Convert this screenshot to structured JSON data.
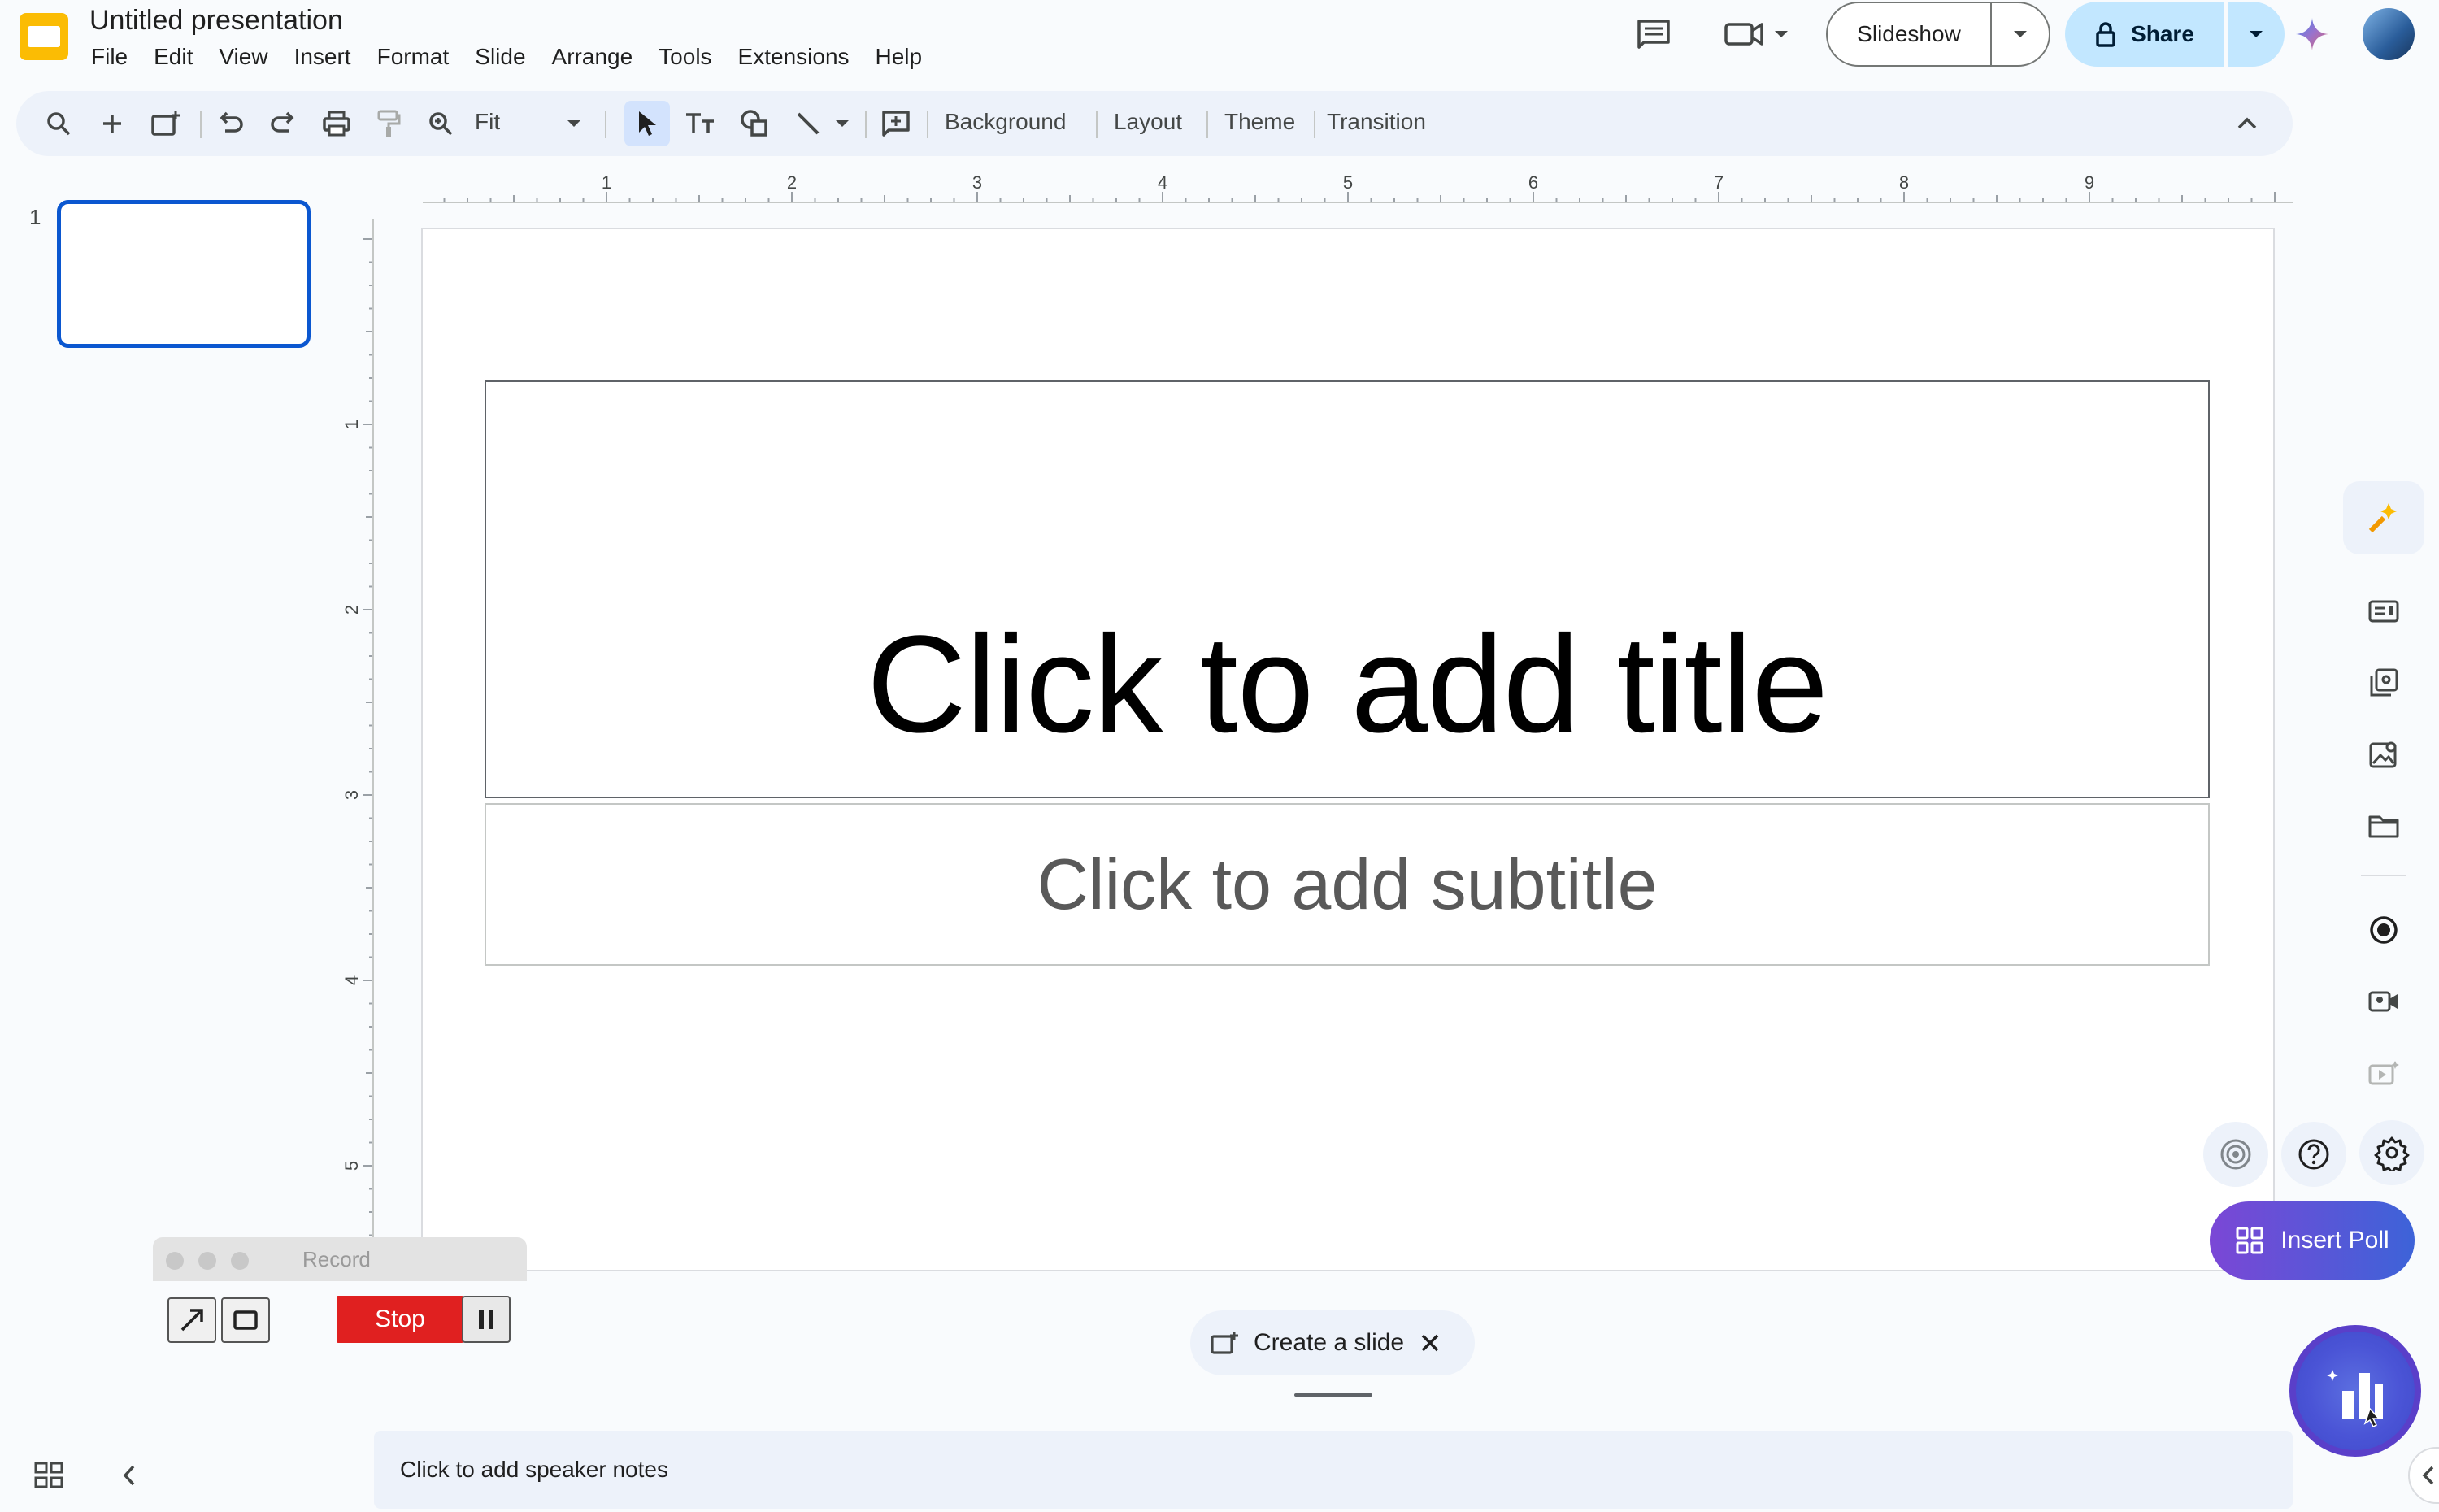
{
  "header": {
    "title": "Untitled presentation",
    "menu": [
      "File",
      "Edit",
      "View",
      "Insert",
      "Format",
      "Slide",
      "Arrange",
      "Tools",
      "Extensions",
      "Help"
    ],
    "slideshow_label": "Slideshow",
    "share_label": "Share"
  },
  "toolbar": {
    "zoom_value": "Fit",
    "background_label": "Background",
    "layout_label": "Layout",
    "theme_label": "Theme",
    "transition_label": "Transition"
  },
  "filmstrip": {
    "slide_number": "1"
  },
  "rulers": {
    "horizontal": [
      "1",
      "2",
      "3",
      "4",
      "5",
      "6",
      "7",
      "8",
      "9"
    ],
    "vertical": [
      "1",
      "2",
      "3",
      "4",
      "5"
    ]
  },
  "slide": {
    "title_placeholder": "Click to add title",
    "subtitle_placeholder": "Click to add subtitle"
  },
  "record": {
    "title": "Record",
    "stop_label": "Stop"
  },
  "create_slide": {
    "label": "Create a slide"
  },
  "notes": {
    "placeholder": "Click to add speaker notes"
  },
  "addon": {
    "insert_poll_label": "Insert Poll"
  },
  "colors": {
    "accent": "#0b57d0",
    "share_bg": "#c2e7ff",
    "stop_red": "#e02020",
    "poll_gradient_start": "#7b47d6",
    "poll_gradient_end": "#3d63d8"
  }
}
